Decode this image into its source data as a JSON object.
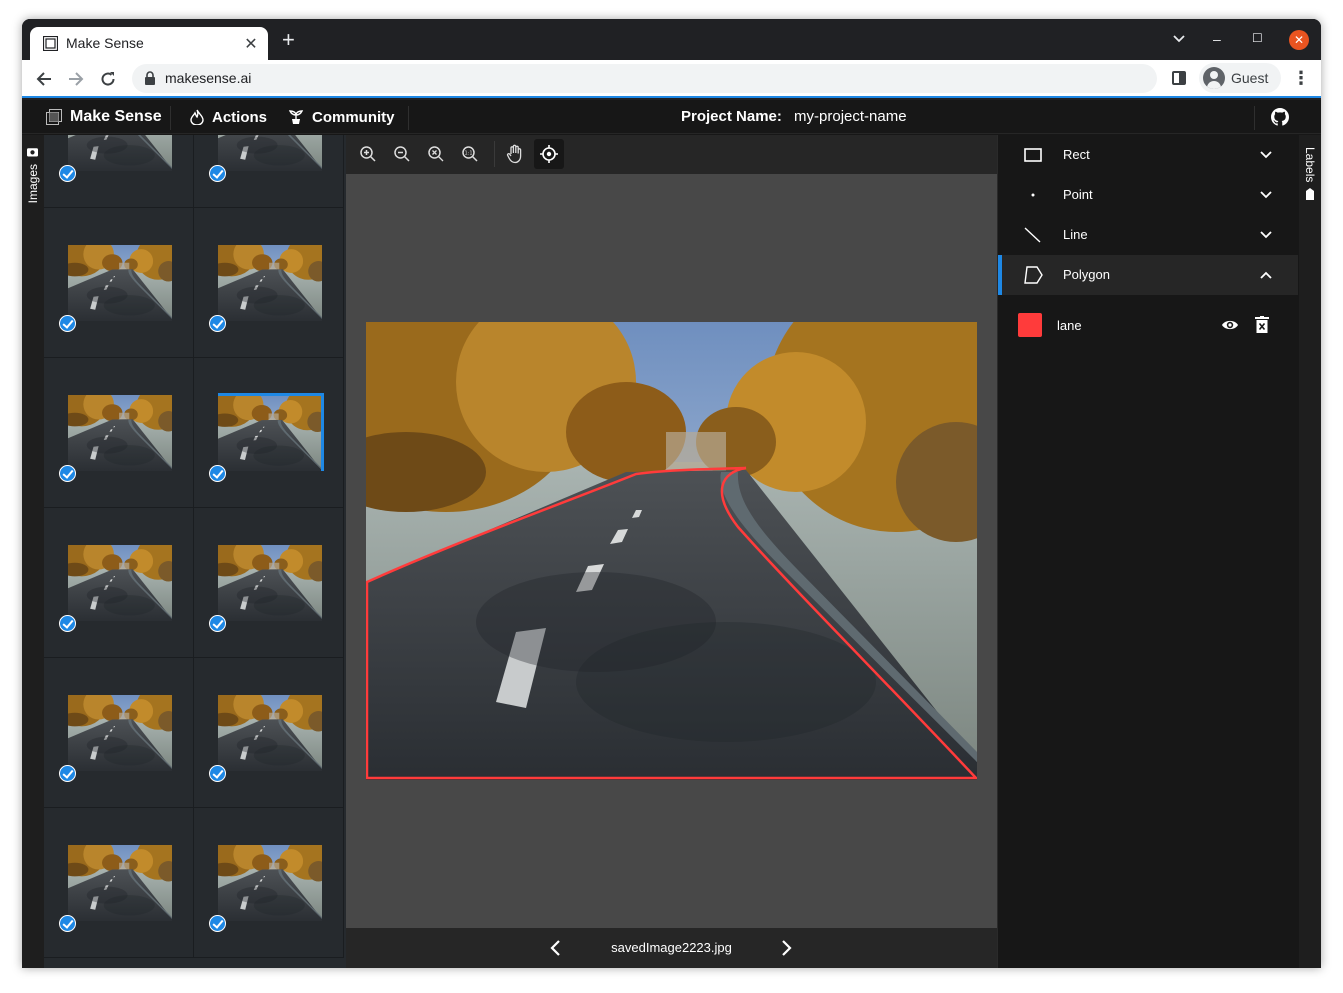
{
  "browser": {
    "tab_title": "Make Sense",
    "url": "makesense.ai",
    "profile_name": "Guest",
    "new_tab": "+",
    "tab_close": "✕",
    "kebab": "⋮",
    "minimize": "–",
    "maximize": "☐",
    "close": "✕"
  },
  "app": {
    "brand": "Make Sense",
    "nav": {
      "actions": "Actions",
      "community": "Community"
    },
    "project_label": "Project Name:",
    "project_name": "my-project-name",
    "images_rail_label": "Images",
    "labels_rail_label": "Labels"
  },
  "editor": {
    "filename": "savedImage2223.jpg",
    "active_tool": "crosshair"
  },
  "tools": [
    {
      "label": "Rect",
      "icon": "rect-icon",
      "expanded": false
    },
    {
      "label": "Point",
      "icon": "point-icon",
      "expanded": false
    },
    {
      "label": "Line",
      "icon": "line-icon",
      "expanded": false
    },
    {
      "label": "Polygon",
      "icon": "polygon-icon",
      "expanded": true
    }
  ],
  "labels": [
    {
      "name": "lane",
      "color": "#ff3b3b"
    }
  ],
  "thumbnails": {
    "count": 12,
    "selected_index": 5,
    "all_checked": true
  },
  "colors": {
    "accent": "#1e88e5",
    "polygon": "#ff3b3b",
    "panel_bg": "#171717",
    "editor_bg": "#484848"
  }
}
